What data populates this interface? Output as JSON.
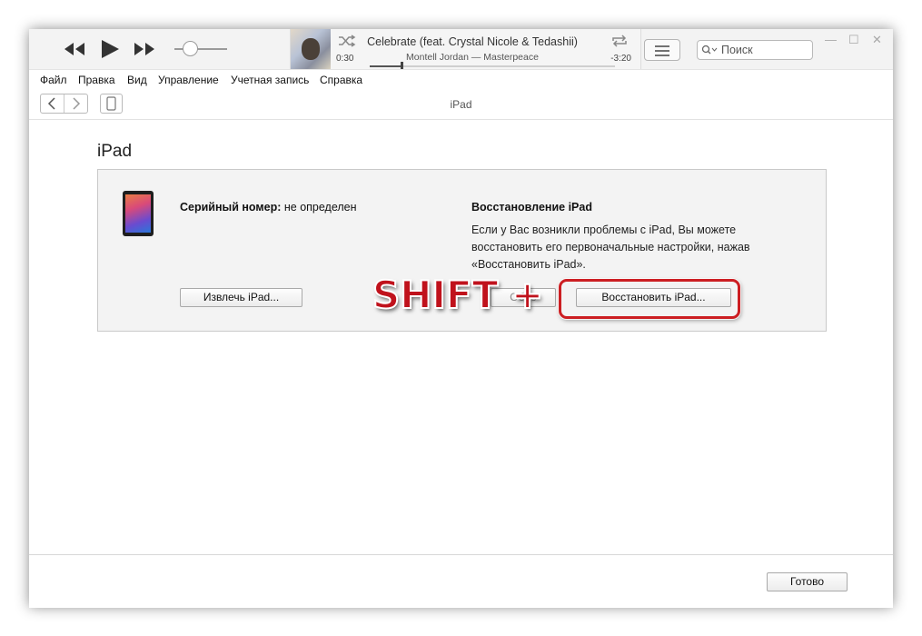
{
  "player": {
    "track_title": "Celebrate (feat. Crystal Nicole & Tedashii)",
    "track_subtitle": "Montell Jordan — Masterpeace",
    "elapsed": "0:30",
    "remaining": "-3:20",
    "progress_fraction": 0.13,
    "volume_fraction": 0.3
  },
  "search": {
    "placeholder": "Поиск"
  },
  "window_controls": {
    "minimize": "—",
    "maximize": "☐",
    "close": "✕"
  },
  "menu": {
    "items": [
      "Файл",
      "Правка",
      "Вид",
      "Управление",
      "Учетная запись",
      "Справка"
    ]
  },
  "nav": {
    "title": "iPad"
  },
  "main": {
    "page_title": "iPad",
    "serial_label": "Серийный номер:",
    "serial_value": "не определен",
    "restore_heading": "Восстановление iPad",
    "restore_description": "Если у Вас возникли проблемы с iPad, Вы можете восстановить его первоначальные настройки, нажав «Восстановить iPad».",
    "eject_button": "Извлечь iPad...",
    "update_button_partial": "Обно",
    "restore_button": "Восстановить iPad..."
  },
  "overlay": {
    "shift_text": "SHIFT +",
    "highlight_color": "#cc1e22"
  },
  "footer": {
    "done_button": "Готово"
  }
}
